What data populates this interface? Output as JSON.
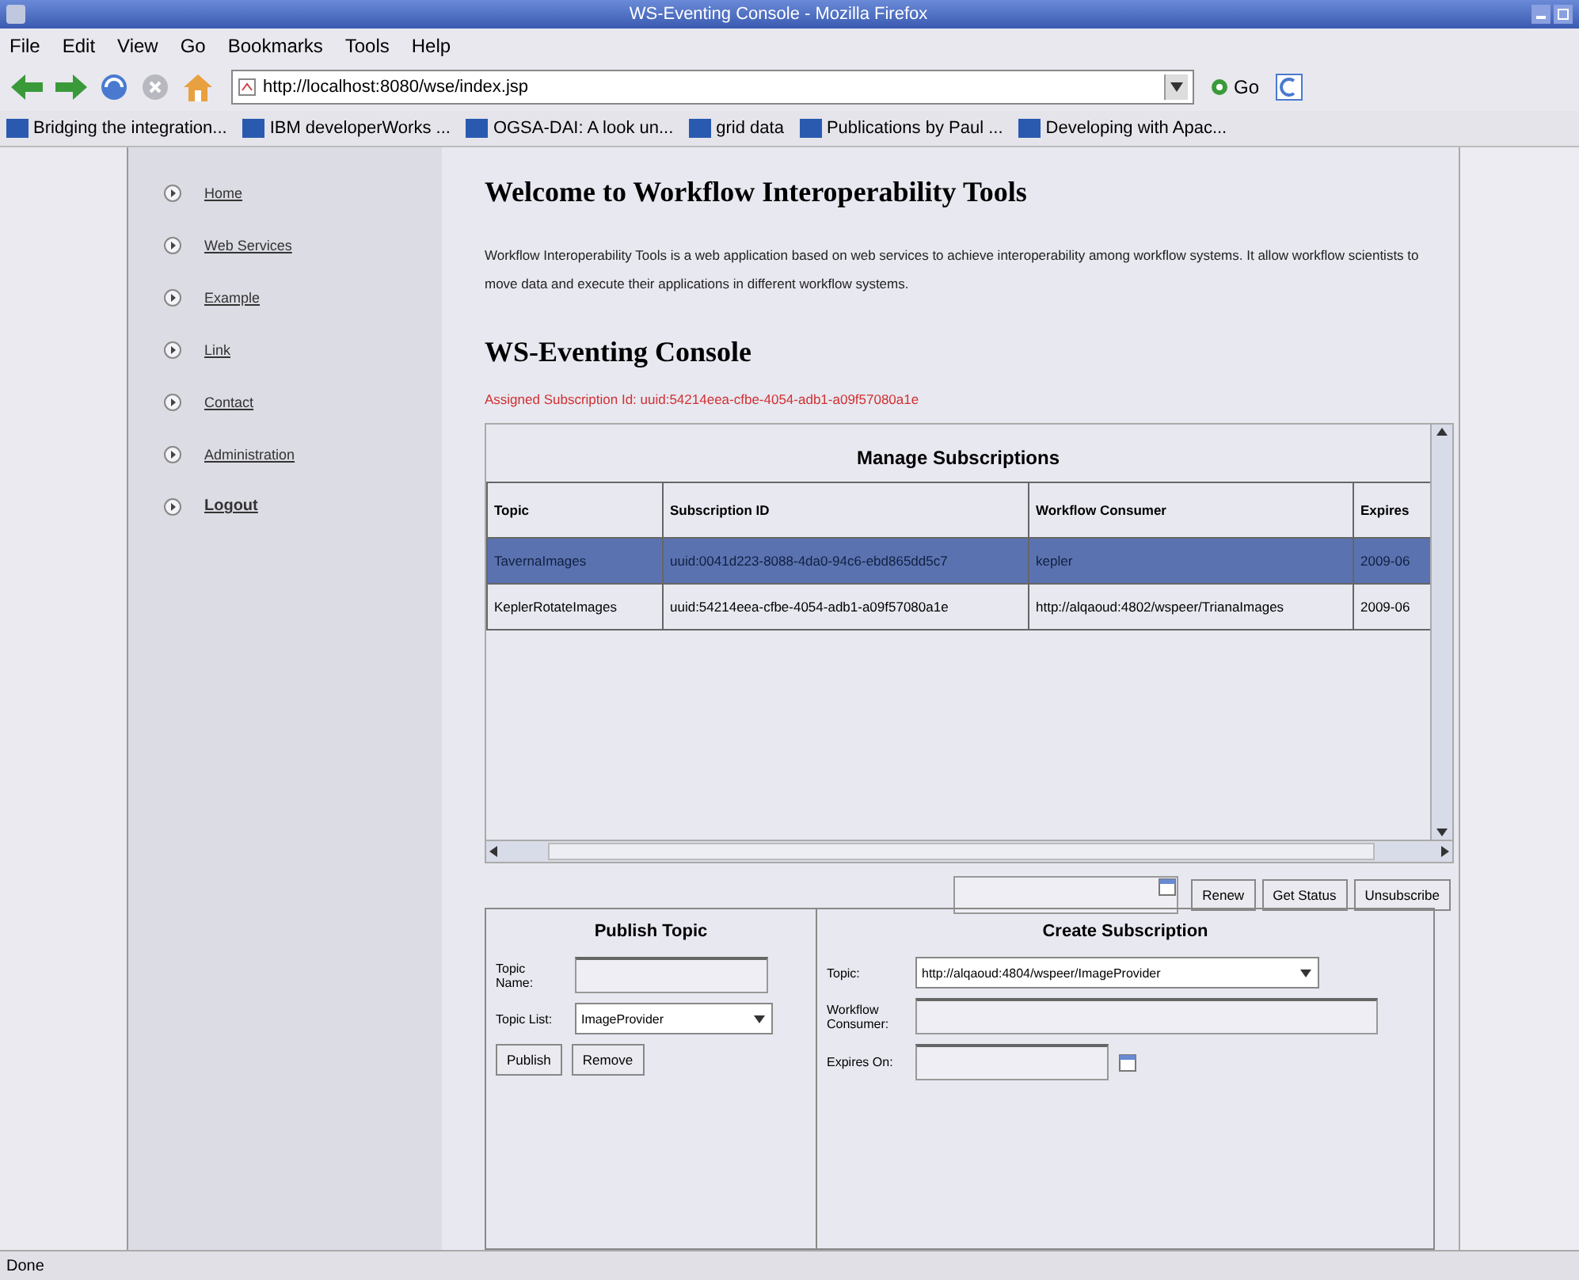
{
  "window": {
    "title": "WS-Eventing Console - Mozilla Firefox"
  },
  "menu": [
    "File",
    "Edit",
    "View",
    "Go",
    "Bookmarks",
    "Tools",
    "Help"
  ],
  "address": {
    "value": "http://localhost:8080/wse/index.jsp",
    "go": "Go"
  },
  "bookmarks": [
    "Bridging the integration...",
    "IBM developerWorks ...",
    "OGSA-DAI: A look un...",
    "grid data",
    "Publications by Paul ...",
    "Developing with Apac..."
  ],
  "sidebar": {
    "items": [
      {
        "label": "Home",
        "bold": false
      },
      {
        "label": "Web Services",
        "bold": false
      },
      {
        "label": "Example",
        "bold": false
      },
      {
        "label": "Link",
        "bold": false
      },
      {
        "label": "Contact",
        "bold": false
      },
      {
        "label": "Administration",
        "bold": false
      },
      {
        "label": "Logout",
        "bold": true
      }
    ]
  },
  "page": {
    "heading": "Welcome to Workflow Interoperability Tools",
    "intro": "Workflow Interoperability Tools is a web application based on web services to achieve interoperability among workflow systems. It allow workflow scientists to move data and execute their applications in different workflow systems.",
    "console_heading": "WS-Eventing Console",
    "assigned": "Assigned Subscription Id: uuid:54214eea-cfbe-4054-adb1-a09f57080a1e"
  },
  "table": {
    "title": "Manage Subscriptions",
    "columns": [
      "Topic",
      "Subscription ID",
      "Workflow Consumer",
      "Expires"
    ],
    "rows": [
      {
        "cells": [
          "TavernaImages",
          "uuid:0041d223-8088-4da0-94c6-ebd865dd5c7",
          "kepler",
          "2009-06"
        ],
        "selected": true
      },
      {
        "cells": [
          "KeplerRotateImages",
          "uuid:54214eea-cfbe-4054-adb1-a09f57080a1e",
          "http://alqaoud:4802/wspeer/TrianaImages",
          "2009-06"
        ],
        "selected": false
      }
    ]
  },
  "actions": [
    "Renew",
    "Get Status",
    "Unsubscribe"
  ],
  "publish": {
    "title": "Publish Topic",
    "name_label": "Topic Name:",
    "list_label": "Topic List:",
    "list_value": "ImageProvider",
    "buttons": [
      "Publish",
      "Remove"
    ]
  },
  "create": {
    "title": "Create Subscription",
    "topic_label": "Topic:",
    "topic_value": "http://alqaoud:4804/wspeer/ImageProvider",
    "consumer_label": "Workflow Consumer:",
    "expires_label": "Expires On:"
  },
  "status_bar": "Done"
}
